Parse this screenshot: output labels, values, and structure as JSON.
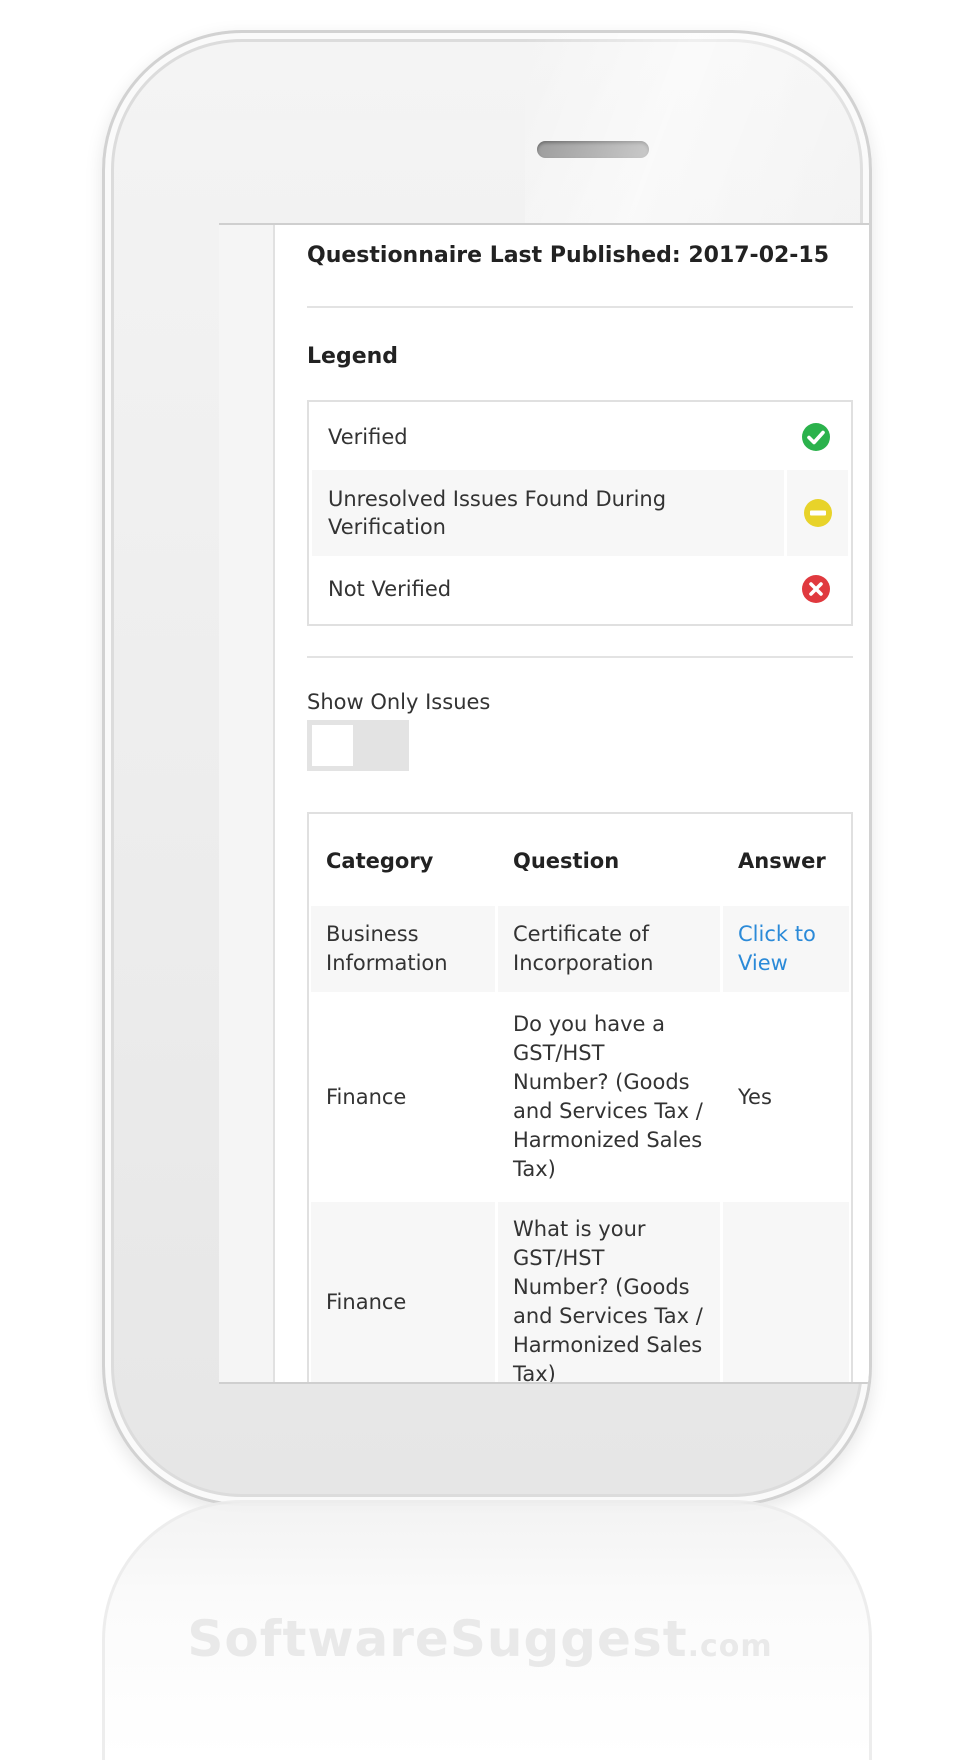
{
  "header": {
    "published_label": "Questionnaire Last Published: 2017-02-15"
  },
  "legend": {
    "title": "Legend",
    "items": [
      {
        "label": "Verified",
        "icon": "check-circle-icon",
        "color": "#2bb24c"
      },
      {
        "label": "Unresolved Issues Found During Verification",
        "icon": "minus-circle-icon",
        "color": "#e8d32a"
      },
      {
        "label": "Not Verified",
        "icon": "x-circle-icon",
        "color": "#e0393e"
      }
    ]
  },
  "filter": {
    "label": "Show Only Issues",
    "enabled": false
  },
  "table": {
    "headers": [
      "Category",
      "Question",
      "Answer"
    ],
    "rows": [
      {
        "category": "Business Information",
        "question": "Certificate of Incorporation",
        "answer": "Click to View"
      },
      {
        "category": "Finance",
        "question": "Do you have a GST/HST Number? (Goods and Services Tax / Harmonized Sales Tax)",
        "answer": "Yes"
      },
      {
        "category": "Finance",
        "question": "What is your GST/HST Number? (Goods and Services Tax / Harmonized Sales Tax)",
        "answer": ""
      }
    ]
  },
  "watermark": {
    "brand": "SoftwareSuggest",
    "suffix": ".com"
  },
  "colors": {
    "link": "#2b8ad8",
    "verified": "#2bb24c",
    "unresolved": "#e8d32a",
    "not_verified": "#e0393e"
  }
}
